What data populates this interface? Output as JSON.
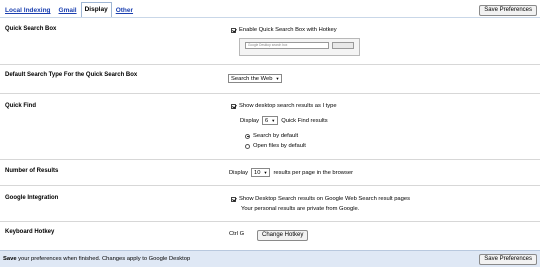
{
  "tabs": [
    {
      "label": "Local Indexing"
    },
    {
      "label": "Gmail"
    },
    {
      "label": "Display"
    },
    {
      "label": "Other"
    }
  ],
  "active_tab": "Display",
  "save_button_label": "Save Preferences",
  "sections": {
    "quick_search_box": {
      "label": "Quick Search Box",
      "enable_label": "Enable Quick Search Box with Hotkey",
      "enable_checked": true,
      "preview_placeholder": "Google Desktop search box"
    },
    "default_search_type": {
      "label": "Default Search Type For the Quick Search Box",
      "selected": "Search the Web"
    },
    "quick_find": {
      "label": "Quick Find",
      "show_label": "Show desktop search results as I type",
      "show_checked": true,
      "display_prefix": "Display",
      "display_count": "6",
      "display_suffix": "Quick Find results",
      "radio_search": "Search by default",
      "radio_open": "Open files by default",
      "radio_selected": "search"
    },
    "number_of_results": {
      "label": "Number of Results",
      "prefix": "Display",
      "count": "10",
      "suffix": "results per page in the browser"
    },
    "google_integration": {
      "label": "Google Integration",
      "show_label": "Show Desktop Search results on Google Web Search result pages",
      "show_checked": true,
      "private_note": "Your personal results are private from Google."
    },
    "keyboard_hotkey": {
      "label": "Keyboard Hotkey",
      "current": "Ctrl G",
      "change_label": "Change Hotkey"
    }
  },
  "footer": {
    "bold": "Save",
    "text": " your preferences when finished. Changes apply to Google Desktop"
  }
}
